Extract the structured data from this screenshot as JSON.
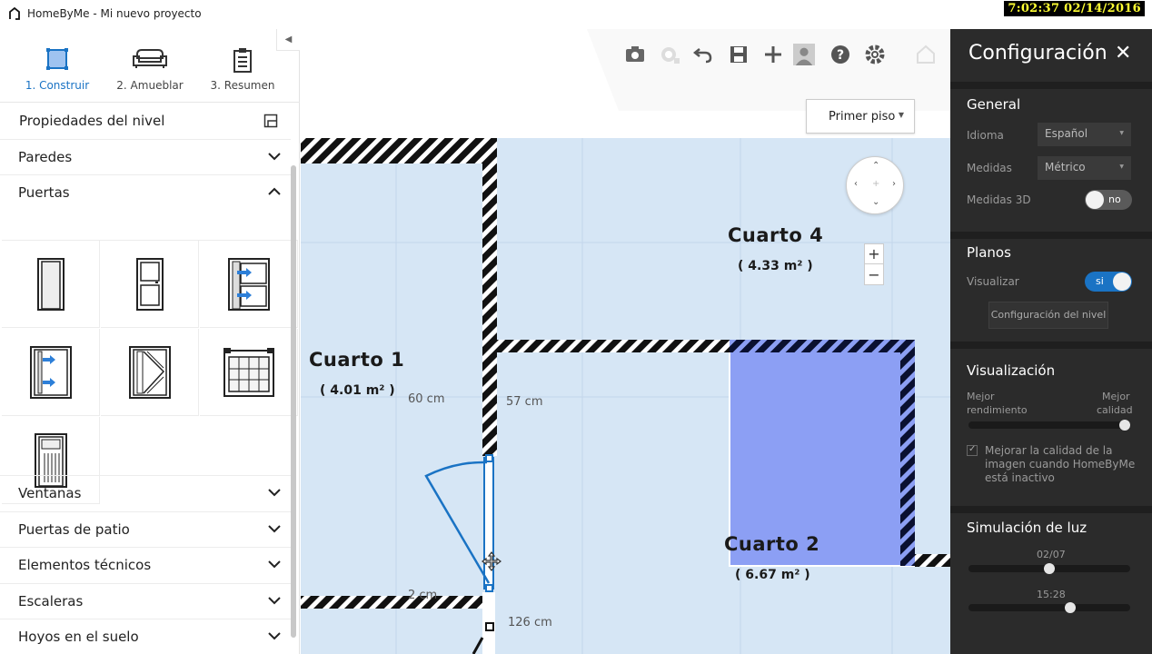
{
  "window": {
    "title": "HomeByMe - Mi nuevo proyecto",
    "clock": "7:02:37  02/14/2016"
  },
  "steps": [
    {
      "label": "1. Construir",
      "icon": "floor-square-icon",
      "active": true
    },
    {
      "label": "2. Amueblar",
      "icon": "sofa-icon",
      "active": false
    },
    {
      "label": "3. Resumen",
      "icon": "clipboard-icon",
      "active": false
    }
  ],
  "left_panel": {
    "level_props_label": "Propiedades del nivel",
    "sections": {
      "paredes": "Paredes",
      "puertas": "Puertas",
      "ventanas": "Ventanas",
      "puertas_patio": "Puertas de patio",
      "elementos_tecnicos": "Elementos técnicos",
      "escaleras": "Escaleras",
      "hoyos": "Hoyos en el suelo"
    },
    "door_items": [
      "simple-door-icon",
      "panel-door-icon",
      "double-door-blue-icon",
      "double-door-left-icon",
      "chevron-door-icon",
      "glass-grid-door-icon",
      "glazed-door-icon"
    ]
  },
  "toolbar": {
    "tools": [
      "camera-icon",
      "snapshot-icon",
      "undo-icon",
      "save-icon",
      "add-icon",
      "user-icon",
      "help-icon",
      "settings-icon",
      "home-icon"
    ],
    "floor_select": "Primer piso"
  },
  "plan": {
    "rooms": [
      {
        "name": "Cuarto 1",
        "area": "( 4.01 m² )"
      },
      {
        "name": "Cuarto 4",
        "area": "( 4.33 m² )"
      },
      {
        "name": "Cuarto 2",
        "area": "( 6.67 m² )"
      }
    ],
    "dims": {
      "d60": "60 cm",
      "d57": "57 cm",
      "d2": "2 cm",
      "d126": "126 cm"
    },
    "zoom_in": "+",
    "zoom_out": "−"
  },
  "config": {
    "title": "Configuración",
    "general": {
      "heading": "General",
      "idioma_label": "Idioma",
      "idioma_value": "Español",
      "medidas_label": "Medidas",
      "medidas_value": "Métrico",
      "medidas3d_label": "Medidas 3D",
      "medidas3d_toggle": "no"
    },
    "planos": {
      "heading": "Planos",
      "visualizar_label": "Visualizar",
      "visualizar_toggle": "si",
      "config_nivel_button": "Configuración del nivel"
    },
    "visualizacion": {
      "heading": "Visualización",
      "left_label_1": "Mejor",
      "left_label_2": "rendimiento",
      "right_label_1": "Mejor",
      "right_label_2": "calidad",
      "quality_level": 1.0,
      "checkbox_text": "Mejorar la calidad de la imagen cuando HomeByMe está inactivo",
      "checkbox_checked": true
    },
    "simulacion": {
      "heading": "Simulación de luz",
      "date_label": "02/07",
      "date_level": 0.5,
      "time_label": "15:28",
      "time_level": 0.64
    }
  },
  "colors": {
    "accent": "#1a73c4",
    "room_fill": "#d6e6f5",
    "selected_room": "#8c9ff4",
    "panel_dark": "#2b2b2b"
  }
}
